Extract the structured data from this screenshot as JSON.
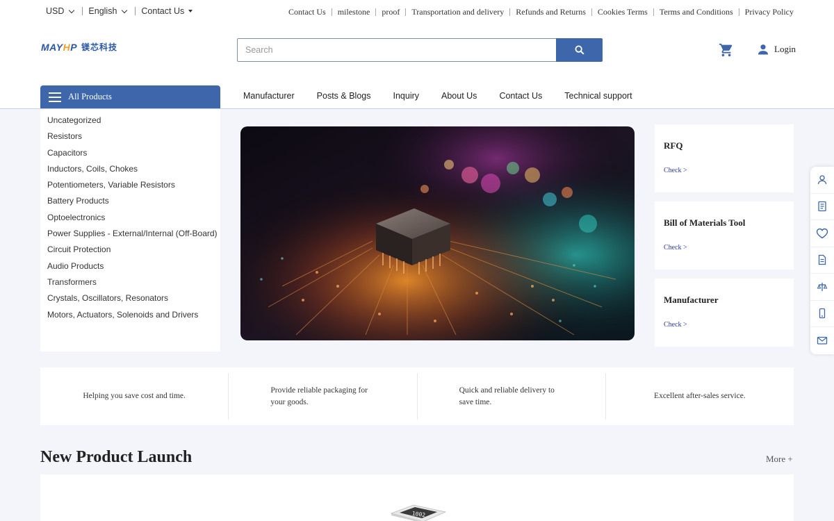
{
  "topbar": {
    "currency": "USD",
    "language": "English",
    "contact": "Contact Us",
    "links": [
      "Contact Us",
      "milestone",
      "proof",
      "Transportation and delivery",
      "Refunds and Returns",
      "Cookies Terms",
      "Terms and Conditions",
      "Privacy Policy"
    ]
  },
  "header": {
    "logo_mark_a": "MAY",
    "logo_mark_b": "H",
    "logo_mark_c": "P",
    "logo_cn": "镁芯科技",
    "search_placeholder": "Search",
    "login": "Login"
  },
  "nav": {
    "all_products": "All Products",
    "items": [
      "Manufacturer",
      "Posts & Blogs",
      "Inquiry",
      "About Us",
      "Contact Us",
      "Technical support"
    ]
  },
  "categories": [
    "Uncategorized",
    "Resistors",
    "Capacitors",
    "Inductors, Coils, Chokes",
    "Potentiometers, Variable Resistors",
    "Battery Products",
    "Optoelectronics",
    "Power Supplies - External/Internal (Off-Board)",
    "Circuit Protection",
    "Audio Products",
    "Transformers",
    "Crystals, Oscillators, Resonators",
    "Motors, Actuators, Solenoids and Drivers"
  ],
  "cards": [
    {
      "title": "RFQ",
      "link": "Check >"
    },
    {
      "title": "Bill of Materials Tool",
      "link": "Check >"
    },
    {
      "title": "Manufacturer",
      "link": "Check >"
    }
  ],
  "features": [
    "Helping you save cost and time.",
    "Provide reliable packaging for your goods.",
    "Quick and reliable delivery to save time.",
    "Excellent after-sales service."
  ],
  "new_products": {
    "title": "New Product Launch",
    "more": "More +",
    "chip_label": "1002"
  },
  "floating_icons": [
    "user-icon",
    "document-icon",
    "heart-icon",
    "file-icon",
    "scale-icon",
    "phone-icon",
    "mail-icon"
  ],
  "colors": {
    "accent": "#3d66ab",
    "link": "#2a3a9a",
    "background": "#f3f5fa"
  }
}
